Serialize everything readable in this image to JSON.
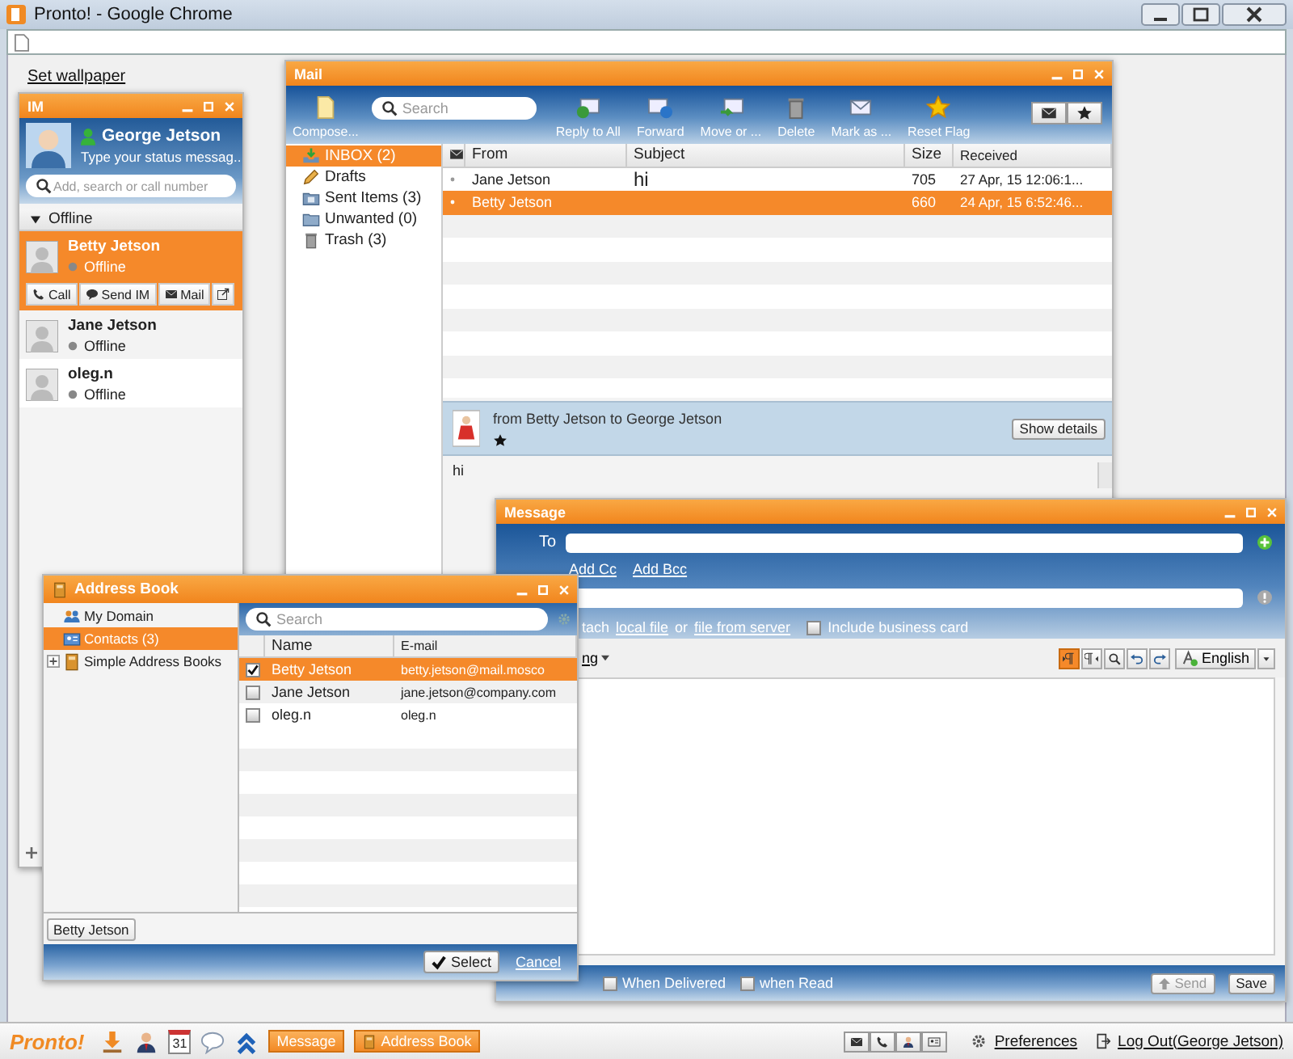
{
  "browser": {
    "title": "Pronto! - Google Chrome"
  },
  "wallpaper_link": "Set wallpaper",
  "im": {
    "title": "IM",
    "user": "George Jetson",
    "status_message": "Type your status messag...",
    "search_placeholder": "Add, search or call number",
    "group": {
      "label": "Offline",
      "expanded": true
    },
    "contacts": [
      {
        "name": "Betty Jetson",
        "status": "Offline",
        "selected": true
      },
      {
        "name": "Jane Jetson",
        "status": "Offline",
        "selected": false
      },
      {
        "name": "oleg.n",
        "status": "Offline",
        "selected": false
      }
    ],
    "actions": [
      {
        "kind": "call",
        "label": "Call"
      },
      {
        "kind": "im",
        "label": "Send IM"
      },
      {
        "kind": "mail",
        "label": "Mail"
      }
    ]
  },
  "mail": {
    "title": "Mail",
    "compose": "Compose...",
    "search_placeholder": "Search",
    "toolbar": [
      {
        "kind": "reply_all",
        "label": "Reply to All"
      },
      {
        "kind": "forward",
        "label": "Forward"
      },
      {
        "kind": "move",
        "label": "Move or ..."
      },
      {
        "kind": "delete",
        "label": "Delete"
      },
      {
        "kind": "mark",
        "label": "Mark as ..."
      },
      {
        "kind": "flag",
        "label": "Reset Flag"
      }
    ],
    "folders": [
      {
        "kind": "inbox",
        "label": "INBOX (2)",
        "selected": true
      },
      {
        "kind": "drafts",
        "label": "Drafts",
        "selected": false
      },
      {
        "kind": "sent",
        "label": "Sent Items (3)",
        "selected": false
      },
      {
        "kind": "folder",
        "label": "Unwanted (0)",
        "selected": false
      },
      {
        "kind": "trash",
        "label": "Trash (3)",
        "selected": false
      }
    ],
    "columns": [
      "From",
      "Subject",
      "Size",
      "Received"
    ],
    "rows": [
      {
        "from": "Jane Jetson",
        "subject": "hi",
        "size": "705",
        "received": "27 Apr, 15 12:06:1...",
        "selected": false
      },
      {
        "from": "Betty Jetson",
        "size": "660",
        "received": "24 Apr, 15 6:52:46...",
        "selected": true
      }
    ],
    "preview": {
      "header": "from Betty Jetson to George Jetson",
      "details_button": "Show details",
      "body": "hi"
    }
  },
  "message": {
    "title": "Message",
    "to_label": "To",
    "add_cc": "Add Cc",
    "add_bcc": "Add Bcc",
    "attach_text": "tach",
    "local_file": "local file",
    "or": "or",
    "file_from_server": "file from server",
    "business_card": {
      "label": "Include business card",
      "checked": false
    },
    "format_menu": "ng",
    "editor_tools": [
      {
        "kind": "ltr",
        "on": true
      },
      {
        "kind": "rtl",
        "on": false
      },
      {
        "kind": "find",
        "on": false
      },
      {
        "kind": "undo",
        "on": false
      },
      {
        "kind": "redo",
        "on": false
      }
    ],
    "language": "English",
    "notify": [
      {
        "label": "When Delivered",
        "checked": false
      },
      {
        "label": "when Read",
        "checked": false
      }
    ],
    "send": {
      "label": "Send",
      "disabled": true
    },
    "save": "Save"
  },
  "address_book": {
    "title": "Address Book",
    "search_placeholder": "Search",
    "folders": [
      {
        "kind": "domain",
        "label": "My Domain",
        "selected": false
      },
      {
        "kind": "contacts",
        "label": "Contacts (3)",
        "selected": true
      },
      {
        "kind": "books",
        "label": "Simple Address Books",
        "selected": false,
        "expanded": false
      }
    ],
    "columns": [
      "Name",
      "E-mail"
    ],
    "contacts": [
      {
        "name": "Betty Jetson",
        "email": "betty.jetson@mail.mosco",
        "checked": true,
        "selected": true
      },
      {
        "name": "Jane Jetson",
        "email": "jane.jetson@company.com",
        "checked": false,
        "selected": false
      },
      {
        "name": "oleg.n",
        "email": "oleg.n",
        "checked": false,
        "selected": false
      }
    ],
    "chosen": [
      "Betty Jetson"
    ],
    "select_button": "Select",
    "cancel_link": "Cancel"
  },
  "taskbar": {
    "logo": "Pronto!",
    "apps": [
      {
        "kind": "download"
      },
      {
        "kind": "contact"
      },
      {
        "kind": "calendar",
        "day": "31"
      },
      {
        "kind": "chat"
      },
      {
        "kind": "up"
      }
    ],
    "windows": [
      {
        "kind": "message",
        "label": "Message"
      },
      {
        "kind": "book",
        "label": "Address Book"
      }
    ],
    "status_buttons": [
      {
        "kind": "mail"
      },
      {
        "kind": "call"
      },
      {
        "kind": "contact"
      },
      {
        "kind": "card"
      }
    ],
    "preferences": "Preferences",
    "logout": "Log Out(George Jetson)"
  }
}
